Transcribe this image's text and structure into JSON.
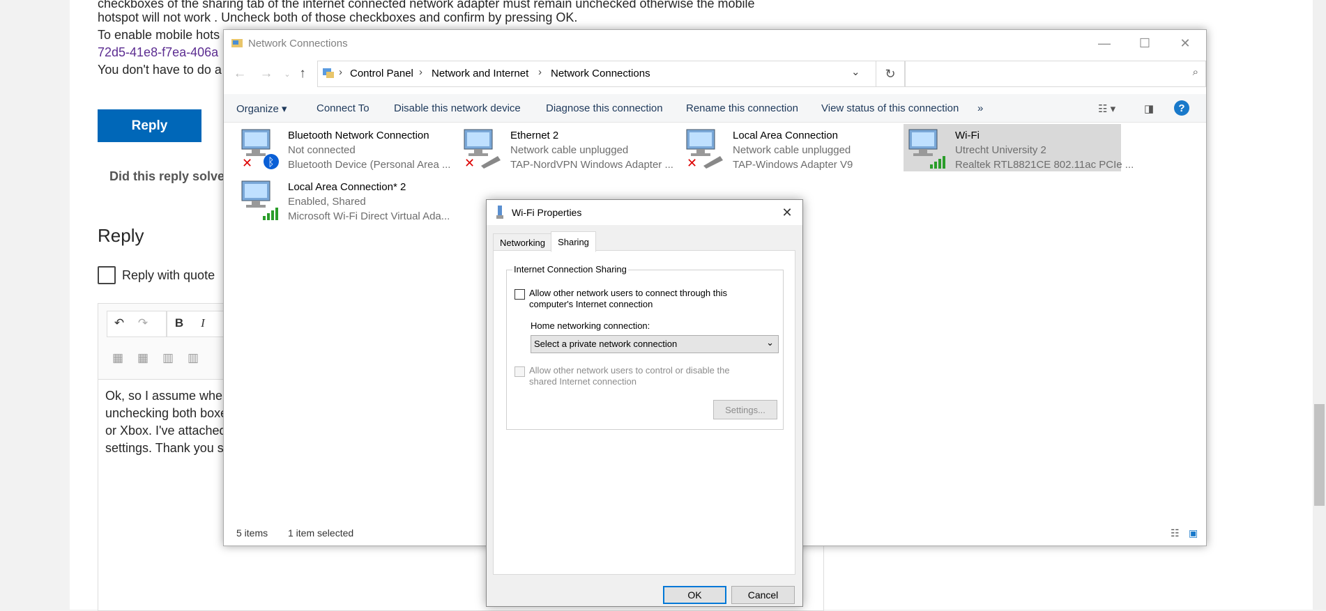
{
  "web": {
    "lines": [
      "checkboxes of the sharing tab of the internet connected network adapter must remain unchecked otherwise the mobile",
      "hotspot will not work . Uncheck both of those checkboxes and confirm by pressing OK.",
      "To enable mobile hots",
      "72d5-41e8-f7ea-406a",
      "You don't have to do a"
    ],
    "reply_button": "Reply",
    "did_this_reply": "Did this reply solve",
    "reply_heading": "Reply",
    "reply_with_quote": "Reply with quote",
    "toolbar": {
      "bold": "B",
      "italic": "I"
    },
    "editor_lines": [
      "Ok, so I assume when",
      "unchecking both boxe",
      "or Xbox. I've attached",
      "settings. Thank you so"
    ]
  },
  "nc_window": {
    "title": "Network Connections",
    "breadcrumb": [
      "Control Panel",
      "Network and Internet",
      "Network Connections"
    ],
    "search_placeholder": "",
    "commands": [
      "Organize",
      "Connect To",
      "Disable this network device",
      "Diagnose this connection",
      "Rename this connection",
      "View status of this connection"
    ],
    "more": "»",
    "help": "?",
    "connections": [
      {
        "name": "Bluetooth Network Connection",
        "status": "Not connected",
        "device": "Bluetooth Device (Personal Area ...",
        "icon": "bluetooth-network-icon",
        "selected": false
      },
      {
        "name": "Ethernet 2",
        "status": "Network cable unplugged",
        "device": "TAP-NordVPN Windows Adapter ...",
        "icon": "ethernet-icon",
        "selected": false
      },
      {
        "name": "Local Area Connection",
        "status": "Network cable unplugged",
        "device": "TAP-Windows Adapter V9",
        "icon": "ethernet-icon",
        "selected": false
      },
      {
        "name": "Wi-Fi",
        "status": "Utrecht University 2",
        "device": "Realtek RTL8821CE 802.11ac PCIe ...",
        "icon": "wifi-network-icon",
        "selected": true
      },
      {
        "name": "Local Area Connection* 2",
        "status": "Enabled, Shared",
        "device": "Microsoft Wi-Fi Direct Virtual Ada...",
        "icon": "wifi-network-icon",
        "selected": false
      }
    ],
    "status_items": "5 items",
    "status_selected": "1 item selected"
  },
  "dialog": {
    "title": "Wi-Fi Properties",
    "tabs": [
      "Networking",
      "Sharing"
    ],
    "active_tab": "Sharing",
    "group_title": "Internet Connection Sharing",
    "allow_connect": "Allow other network users to connect through this computer's Internet connection",
    "allow_connect_line1": "Allow other network users to connect through this",
    "allow_connect_line2": "computer's Internet connection",
    "home_label": "Home networking connection:",
    "home_value": "Select a private network connection",
    "allow_control_line1": "Allow other network users to control or disable the",
    "allow_control_line2": "shared Internet connection",
    "settings_button": "Settings...",
    "ok_button": "OK",
    "cancel_button": "Cancel"
  },
  "colors": {
    "accent": "#0067b8",
    "selection": "#d9d9d9",
    "link": "#5c2d91",
    "help": "#1979ca"
  }
}
